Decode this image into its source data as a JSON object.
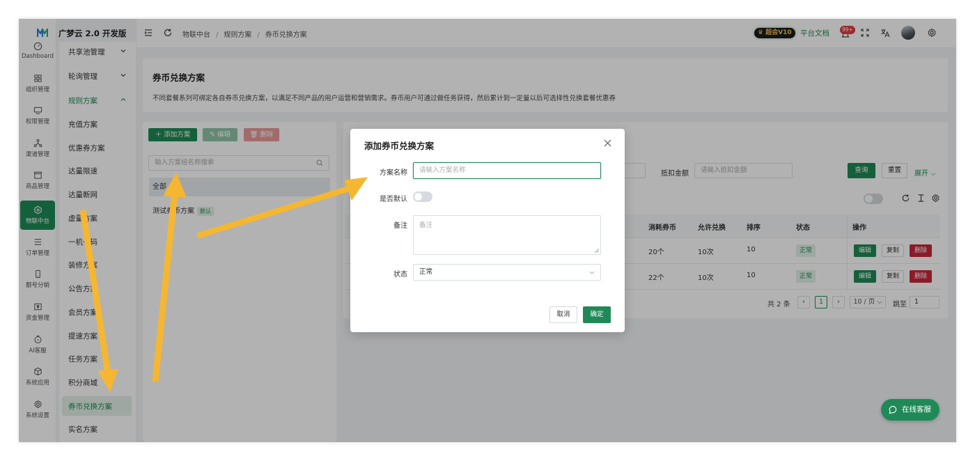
{
  "brand": "广梦云 2.0 开发版",
  "rail": [
    {
      "icon": "dashboard-icon",
      "label": "Dashboard",
      "active": false
    },
    {
      "icon": "organization-icon",
      "label": "组织管理",
      "active": false
    },
    {
      "icon": "permission-icon",
      "label": "权限管理",
      "active": false
    },
    {
      "icon": "channel-icon",
      "label": "渠道管理",
      "active": false
    },
    {
      "icon": "store-icon",
      "label": "商品管理",
      "active": false
    },
    {
      "icon": "iot-icon",
      "label": "物联中台",
      "active": true
    },
    {
      "icon": "order-list-icon",
      "label": "订单管理",
      "active": false
    },
    {
      "icon": "phone-icon",
      "label": "靓号分销",
      "active": false
    },
    {
      "icon": "wallet-icon",
      "label": "资金管理",
      "active": false
    },
    {
      "icon": "ai-icon",
      "label": "AI客服",
      "active": false
    },
    {
      "icon": "cube-icon",
      "label": "系统应用",
      "active": false
    },
    {
      "icon": "gear-icon",
      "label": "系统设置",
      "active": false
    }
  ],
  "submenu": [
    {
      "label": "共享池管理",
      "chevron": "down",
      "state": ""
    },
    {
      "label": "轮询管理",
      "chevron": "down",
      "state": ""
    },
    {
      "label": "规则方案",
      "chevron": "up",
      "state": "open"
    },
    {
      "label": "充值方案",
      "chevron": "",
      "state": ""
    },
    {
      "label": "优惠券方案",
      "chevron": "",
      "state": ""
    },
    {
      "label": "达量限速",
      "chevron": "",
      "state": ""
    },
    {
      "label": "达量断网",
      "chevron": "",
      "state": ""
    },
    {
      "label": "虚量方案",
      "chevron": "",
      "state": ""
    },
    {
      "label": "一机一码",
      "chevron": "",
      "state": ""
    },
    {
      "label": "装修方案",
      "chevron": "",
      "state": ""
    },
    {
      "label": "公告方案",
      "chevron": "",
      "state": ""
    },
    {
      "label": "会员方案",
      "chevron": "",
      "state": ""
    },
    {
      "label": "提速方案",
      "chevron": "",
      "state": ""
    },
    {
      "label": "任务方案",
      "chevron": "",
      "state": ""
    },
    {
      "label": "积分商城",
      "chevron": "",
      "state": ""
    },
    {
      "label": "券币兑换方案",
      "chevron": "",
      "state": "selected"
    },
    {
      "label": "实名方案",
      "chevron": "",
      "state": ""
    }
  ],
  "header": {
    "breadcrumb": [
      "物联中台",
      "规则方案",
      "券币兑换方案"
    ],
    "vip_label": "超会V10",
    "doc_link": "平台文档",
    "notif_count": "99+"
  },
  "page": {
    "title": "券币兑换方案",
    "description": "不同套餐系列可绑定各自券币兑换方案，以满足不同产品的用户运营和营销需求。券币用户可通过做任务获得，然后累计到一定量以后可选择性兑换套餐优惠券"
  },
  "left_panel": {
    "add_btn": "添加方案",
    "edit_btn": "编辑",
    "delete_btn": "删除",
    "search_placeholder": "输入方案组名称搜索",
    "all_label": "全部",
    "items": [
      {
        "name": "测试券币方案",
        "tag": "默认"
      }
    ]
  },
  "filter": {
    "deduct_label": "抵扣金额",
    "deduct_placeholder": "请输入抵扣金额",
    "query_btn": "查询",
    "reset_btn": "重置",
    "expand": "展开"
  },
  "table": {
    "columns": [
      "消耗券币",
      "允许兑换",
      "排序",
      "状态",
      "操作"
    ],
    "rows": [
      {
        "coins": "20个",
        "allowed": "10次",
        "sort": "10",
        "status": "正常"
      },
      {
        "coins": "22个",
        "allowed": "10次",
        "sort": "10",
        "status": "正常"
      }
    ],
    "actions": {
      "edit": "编辑",
      "copy": "复制",
      "delete": "删除"
    }
  },
  "pager": {
    "total": "共 2 条",
    "current": "1",
    "page_size": "10 / 页",
    "jump_label": "跳至",
    "jump_value": "1"
  },
  "chat": {
    "label": "在线客服"
  },
  "modal": {
    "title": "添加券币兑换方案",
    "fields": {
      "name_label": "方案名称",
      "name_placeholder": "请输入方案名称",
      "default_label": "是否默认",
      "remark_label": "备注",
      "remark_placeholder": "备注",
      "status_label": "状态",
      "status_value": "正常"
    },
    "cancel": "取消",
    "confirm": "确定"
  },
  "colors": {
    "primary": "#1f8a57",
    "danger": "#c8283a",
    "arrow": "#f5b731"
  }
}
